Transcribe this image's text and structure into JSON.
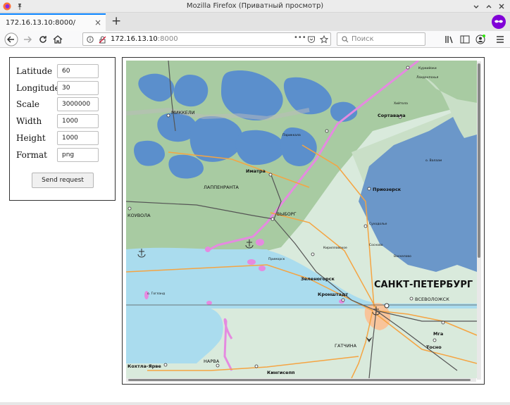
{
  "window": {
    "title": "Mozilla Firefox (Приватный просмотр)"
  },
  "tab": {
    "label": "172.16.13.10:8000/",
    "close": "×"
  },
  "newtab": "+",
  "url": {
    "host": "172.16.13.10",
    "port": ":8000",
    "more": "•••"
  },
  "search": {
    "placeholder": "Поиск"
  },
  "form": {
    "latitude": {
      "label": "Latitude",
      "value": "60"
    },
    "longitude": {
      "label": "Longitude",
      "value": "30"
    },
    "scale": {
      "label": "Scale",
      "value": "3000000"
    },
    "width": {
      "label": "Width",
      "value": "1000"
    },
    "height": {
      "label": "Height",
      "value": "1000"
    },
    "format": {
      "label": "Format",
      "value": "png"
    },
    "send_label": "Send request"
  },
  "map": {
    "labels": {
      "spb": "САНКТ-ПЕТЕРБУРГ",
      "mikkeli": "МИККЕЛИ",
      "lappeenranta": "ЛАППЕНРАНТА",
      "imatra": "Иматра",
      "kouvola": "КОУВОЛА",
      "vyborg": "ВЫБОРГ",
      "priozersk": "Приозерск",
      "sortavala": "Сортавала",
      "zelenogorsk": "Зеленогорск",
      "kronshtadt": "Кронштадт",
      "vsevolozhsk": "ВСЕВОЛОЖСК",
      "gatchina": "ГАТЧИНА",
      "narva": "НАРВА",
      "kingisepp": "Кингисепп",
      "kohtla": "Кохтла-Ярве",
      "mga": "Мга",
      "tosno": "Тосно",
      "primorsk": "Приморск",
      "sosnovo": "Сосново",
      "vaskelovo": "Васкелово",
      "kirillovskoe": "Кирилловское",
      "suhodolye": "Суходолье",
      "kurkijoki": "Куркийоки",
      "lahdenpohja": "Лахденпохья",
      "gotland": "о. Гогланд",
      "valaam": "о. Валаам",
      "khiitola": "Хийтола",
      "parikkala": "Париккала"
    },
    "colors": {
      "lake": "#5b8fcc",
      "forest": "#a8cba2",
      "open": "#d9eadc",
      "sea": "#aadcee",
      "city": "#f8c49a",
      "border": "#e58ae0"
    }
  },
  "icons": [
    "firefox-icon",
    "pin-icon",
    "minimize-icon",
    "maximize-icon",
    "close-icon",
    "back-icon",
    "forward-icon",
    "reload-icon",
    "home-icon",
    "info-icon",
    "insecure-lock-icon",
    "pocket-icon",
    "bookmark-star-icon",
    "search-icon",
    "library-icon",
    "sidebar-icon",
    "account-icon",
    "menu-icon",
    "private-mask-icon",
    "anchor-icon",
    "airport-icon"
  ]
}
